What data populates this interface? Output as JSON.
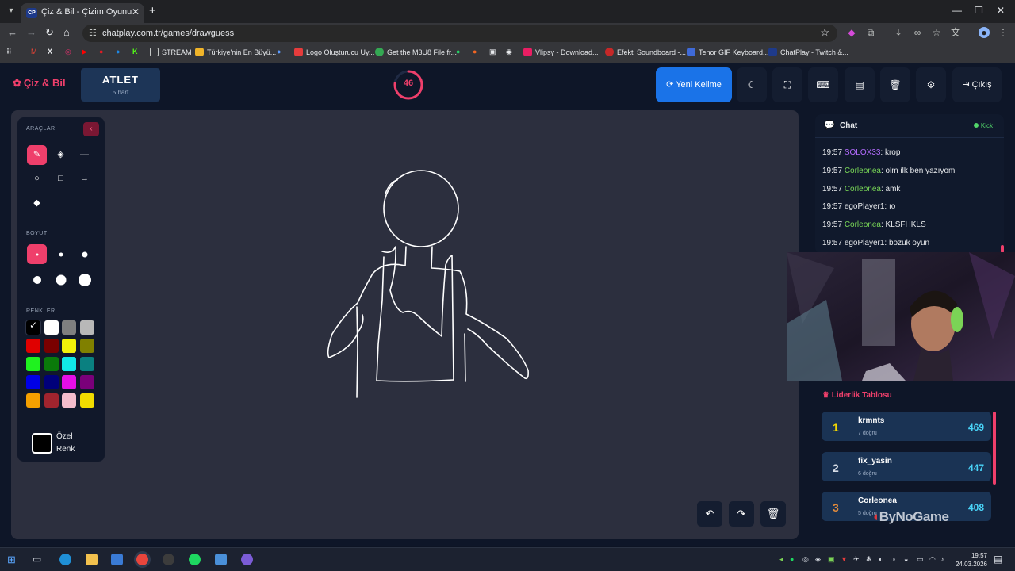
{
  "browser": {
    "tab_title": "Çiz & Bil - Çizim Oyunu",
    "tab_favicon": "CP",
    "url": "chatplay.com.tr/games/drawguess",
    "bookmarks": [
      "STREAM",
      "Türkiye'nin En Büyü...",
      "Logo Oluşturucu Uy...",
      "Get the M3U8 File fr...",
      "Vlipsy - Download...",
      "Efekti Soundboard -...",
      "Tenor GIF Keyboard...",
      "ChatPlay - Twitch &..."
    ]
  },
  "header": {
    "logo": "Çiz & Bil",
    "word": "ATLET",
    "word_length": "5 harf",
    "timer": "46",
    "timer_fraction": 0.77,
    "new_word_label": "Yeni Kelime",
    "logout_label": "Çıkış",
    "icons": [
      "moon-icon",
      "fullscreen-icon",
      "keyboard-icon",
      "archive-icon",
      "trash-icon",
      "gear-icon"
    ]
  },
  "tools": {
    "tools_title": "ARAÇLAR",
    "size_title": "BOYUT",
    "colors_title": "RENKLER",
    "custom_color_line1": "Özel",
    "custom_color_line2": "Renk",
    "colors": [
      "#000000",
      "#ffffff",
      "#7f7f7f",
      "#b8b8b8",
      "#e00000",
      "#7a0000",
      "#f2f20a",
      "#808000",
      "#1ff21f",
      "#0a7a0a",
      "#11e8e8",
      "#0a8080",
      "#0000e6",
      "#00007a",
      "#e60ee6",
      "#7a007a",
      "#f5a000",
      "#a0242e",
      "#f4bccb",
      "#f2dc00"
    ]
  },
  "chat": {
    "title": "Chat",
    "platform": "Kick",
    "messages": [
      {
        "time": "19:57",
        "user": "SOLOX33",
        "text": ": krop",
        "color": "#b46cff"
      },
      {
        "time": "19:57",
        "user": "Corleonea",
        "text": ": olm ilk ben yazıyom",
        "color": "#7ad957"
      },
      {
        "time": "19:57",
        "user": "Corleonea",
        "text": ": amk",
        "color": "#7ad957"
      },
      {
        "time": "19:57",
        "user": "egoPlayer1",
        "text": ": ıo",
        "color": "#e8eaed"
      },
      {
        "time": "19:57",
        "user": "Corleonea",
        "text": ": KLSFHKLS",
        "color": "#7ad957"
      },
      {
        "time": "19:57",
        "user": "egoPlayer1",
        "text": ": bozuk oyun",
        "color": "#e8eaed"
      }
    ]
  },
  "leaderboard": {
    "title": "Liderlik Tablosu",
    "rows": [
      {
        "rank": "1",
        "name": "krmnts",
        "sub": "7 doğru",
        "score": "469",
        "rank_color": "#f5d800"
      },
      {
        "rank": "2",
        "name": "fix_yasin",
        "sub": "6 doğru",
        "score": "447",
        "rank_color": "#d7dde6"
      },
      {
        "rank": "3",
        "name": "Corleonea",
        "sub": "5 doğru",
        "score": "408",
        "rank_color": "#e08a3c"
      }
    ],
    "watermark": "ByNoGame"
  },
  "taskbar": {
    "time": "19:57",
    "date": "24.03.2026"
  }
}
